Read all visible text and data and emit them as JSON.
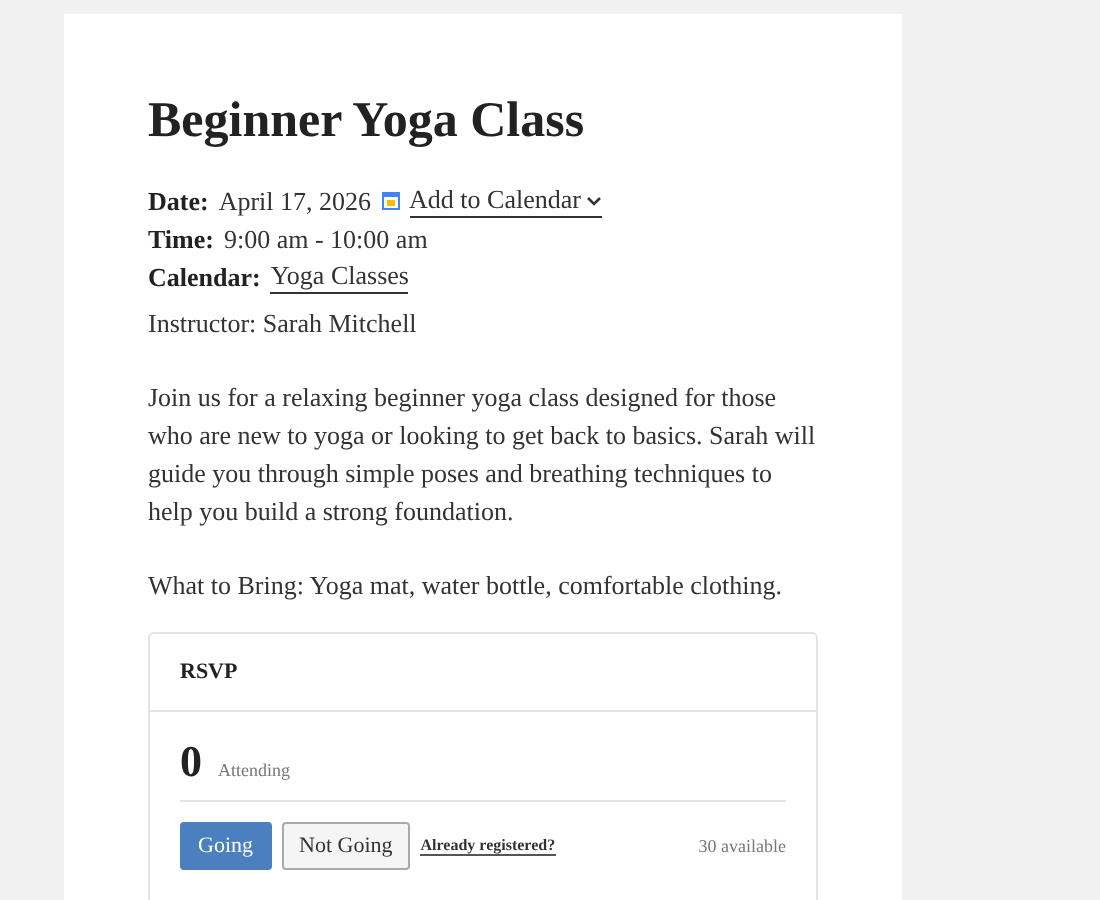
{
  "title": "Beginner Yoga Class",
  "meta": [
    {
      "kind": "date",
      "label": "Date:",
      "value": "April 17, 2026",
      "link": "Add to Calendar"
    },
    {
      "kind": "time",
      "label": "Time:",
      "value": "9:00 am - 10:00 am"
    },
    {
      "kind": "calendar",
      "label": "Calendar:",
      "link": "Yoga Classes"
    }
  ],
  "instructor": "Instructor: Sarah Mitchell",
  "description": "Join us for a relaxing beginner yoga class designed for those who are new to yoga or looking to get back to basics. Sarah will guide you through simple poses and breathing techniques to help you build a strong foundation.",
  "bring": "What to Bring: Yoga mat, water bottle, comfortable clothing.",
  "rsvp": {
    "title": "RSVP",
    "count": "0",
    "count_label": "Attending",
    "buttons": [
      {
        "label": "Going",
        "kind": "primary"
      },
      {
        "label": "Not Going",
        "kind": "secondary"
      }
    ],
    "registered_link": "Already registered?",
    "available": "30 available"
  }
}
